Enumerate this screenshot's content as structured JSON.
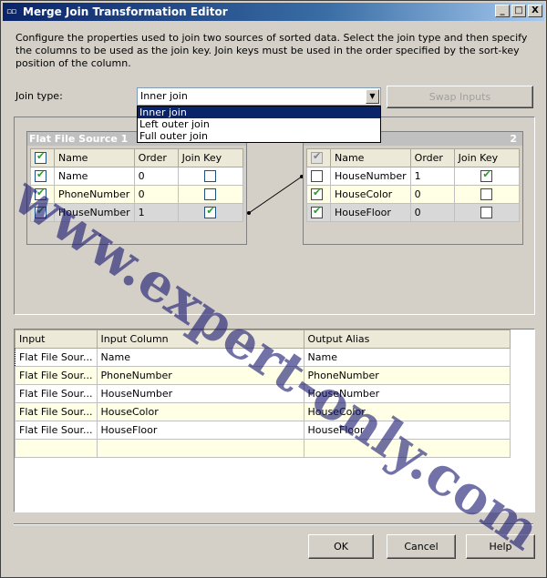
{
  "window": {
    "title": "Merge Join Transformation Editor",
    "title_icon": "▫▫",
    "controls": [
      "_",
      "□",
      "X"
    ]
  },
  "description": "Configure the properties used to join two sources of sorted data. Select the join type and then specify the columns to be used as the join key. Join keys must be used in the order specified by the sort-key position of the column.",
  "join_type": {
    "label": "Join type:",
    "value": "Inner join",
    "options": [
      "Inner join",
      "Left outer join",
      "Full outer join"
    ],
    "selected_index": 0
  },
  "swap_button": "Swap Inputs",
  "left_source": {
    "title": "Flat File Source 1",
    "headers": [
      "Name",
      "Order",
      "Join Key"
    ],
    "rows": [
      {
        "checked": true,
        "name": "Name",
        "order": "0",
        "join_key": false
      },
      {
        "checked": true,
        "name": "PhoneNumber",
        "order": "0",
        "join_key": false
      },
      {
        "checked": true,
        "name": "HouseNumber",
        "order": "1",
        "join_key": true
      }
    ]
  },
  "right_source": {
    "title": "2",
    "headers": [
      "Name",
      "Order",
      "Join Key"
    ],
    "rows": [
      {
        "checked": false,
        "name": "HouseNumber",
        "order": "1",
        "join_key": true
      },
      {
        "checked": true,
        "name": "HouseColor",
        "order": "0",
        "join_key": false
      },
      {
        "checked": true,
        "name": "HouseFloor",
        "order": "0",
        "join_key": false
      }
    ]
  },
  "mapping": {
    "headers": [
      "Input",
      "Input Column",
      "Output Alias"
    ],
    "rows": [
      [
        "Flat File Sour...",
        "Name",
        "Name"
      ],
      [
        "Flat File Sour...",
        "PhoneNumber",
        "PhoneNumber"
      ],
      [
        "Flat File Sour...",
        "HouseNumber",
        "HouseNumber"
      ],
      [
        "Flat File Sour...",
        "HouseColor",
        "HouseColor"
      ],
      [
        "Flat File Sour...",
        "HouseFloor",
        "HouseFloor"
      ]
    ]
  },
  "buttons": {
    "ok": "OK",
    "cancel": "Cancel",
    "help": "Help"
  },
  "watermark": "www.expert-only.com",
  "colors": {
    "titlebar": "#0a246a",
    "selection": "#0a246a",
    "check": "#21a121"
  }
}
